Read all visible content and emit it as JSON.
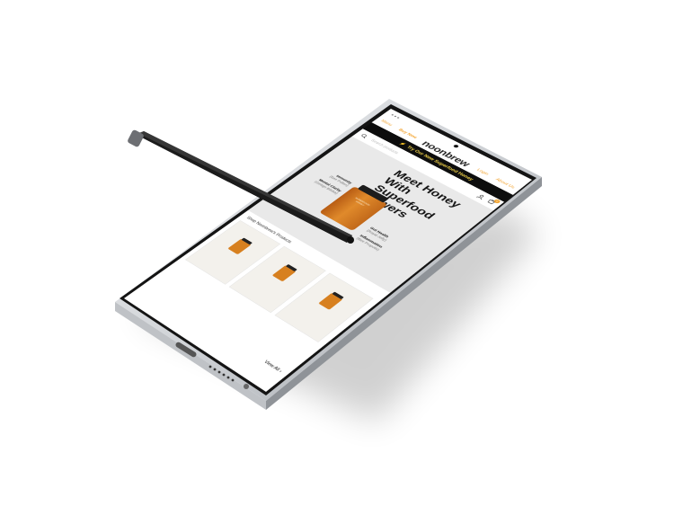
{
  "phone_screen": {
    "nav": {
      "links": [
        "Menu",
        "Buy Now",
        "Login",
        "About Us"
      ],
      "brand": "noonbrew"
    },
    "promo": {
      "text": "Try Our New Superfood Honey"
    },
    "search": {
      "placeholder": "Search products"
    },
    "cart": {
      "count": "0"
    },
    "hero": {
      "headline": "Meet Honey With Superfood Powers",
      "jar_label": "SUPERFOOD HONEY",
      "benefits": [
        {
          "title": "Immunity",
          "sub": "(Bee Pollen)"
        },
        {
          "title": "Mental Clarity",
          "sub": "(Ginkgo Biloba)"
        },
        {
          "title": "Gut Health",
          "sub": "(Royal Jelly)"
        },
        {
          "title": "Inflammation",
          "sub": "(Bee Propolis)"
        }
      ]
    },
    "products": {
      "heading": "Shop Noonbrew's Products",
      "view_all": "View All"
    }
  },
  "colors": {
    "accent": "#f2a22c",
    "promo_bg": "#0d0d0d",
    "promo_text": "#f4d54a",
    "honey": "#d7801f",
    "phone_frame": "#d9dbde",
    "stylus": "#1a1a1a"
  }
}
